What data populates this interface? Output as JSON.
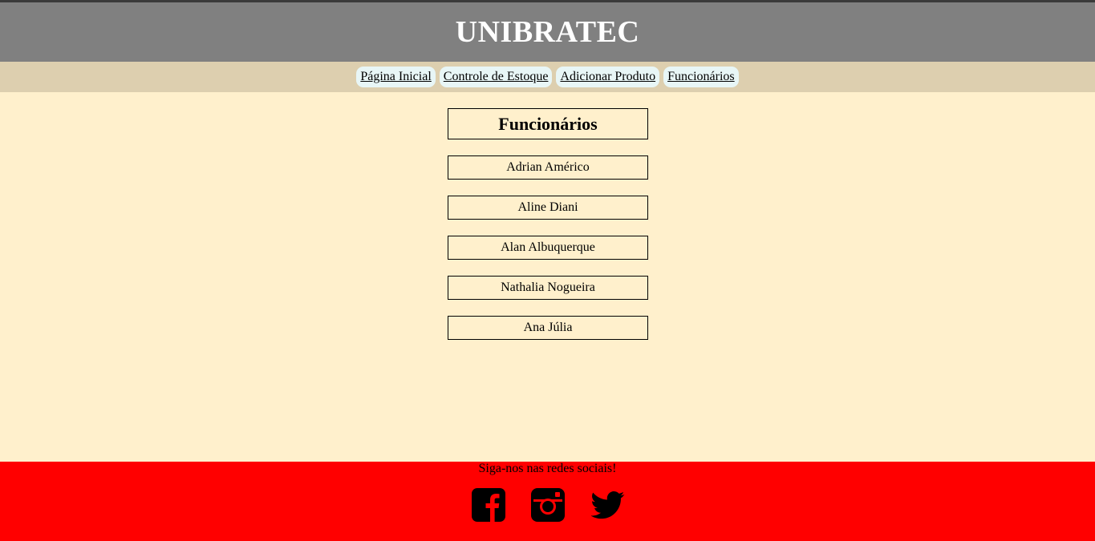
{
  "header": {
    "title": "UNIBRATEC"
  },
  "nav": {
    "items": [
      {
        "label": "Página Inicial"
      },
      {
        "label": "Controle de Estoque"
      },
      {
        "label": "Adicionar Produto"
      },
      {
        "label": "Funcionários"
      }
    ]
  },
  "main": {
    "heading": "Funcionários",
    "employees": [
      {
        "name": "Adrian Américo"
      },
      {
        "name": "Aline Diani"
      },
      {
        "name": "Alan Albuquerque"
      },
      {
        "name": "Nathalia Nogueira"
      },
      {
        "name": "Ana Júlia"
      }
    ]
  },
  "footer": {
    "follow_text": "Siga-nos nas redes sociais!",
    "icons": [
      "facebook-icon",
      "instagram-icon",
      "twitter-icon"
    ]
  },
  "colors": {
    "header_bg": "#808080",
    "nav_bg": "#ddcfaf",
    "nav_item_bg": "#e8f6f6",
    "page_bg": "#fff0cc",
    "footer_bg": "#ff0000"
  }
}
